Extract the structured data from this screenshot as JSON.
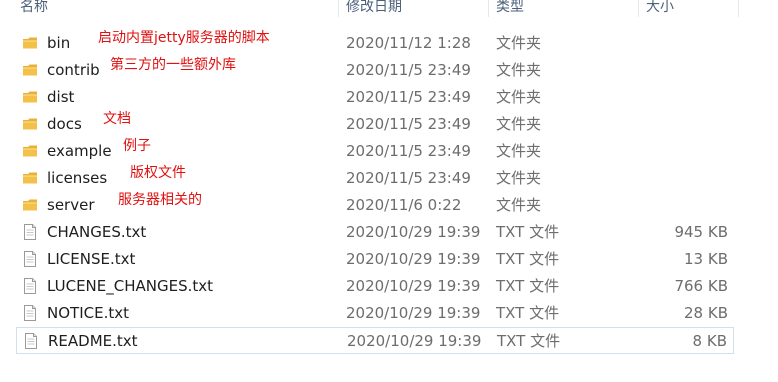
{
  "columns": {
    "name": "名称",
    "date": "修改日期",
    "type": "类型",
    "size": "大小"
  },
  "rows": [
    {
      "name": "bin",
      "date": "2020/11/12 1:28",
      "type": "文件夹",
      "size": "",
      "note": "启动内置jetty服务器的脚本",
      "icon": "folder-icon"
    },
    {
      "name": "contrib",
      "date": "2020/11/5 23:49",
      "type": "文件夹",
      "size": "",
      "note": "第三方的一些额外库",
      "icon": "folder-icon"
    },
    {
      "name": "dist",
      "date": "2020/11/5 23:49",
      "type": "文件夹",
      "size": "",
      "note": "",
      "icon": "folder-icon"
    },
    {
      "name": "docs",
      "date": "2020/11/5 23:49",
      "type": "文件夹",
      "size": "",
      "note": "文档",
      "icon": "folder-icon"
    },
    {
      "name": "example",
      "date": "2020/11/5 23:49",
      "type": "文件夹",
      "size": "",
      "note": "例子",
      "icon": "folder-icon"
    },
    {
      "name": "licenses",
      "date": "2020/11/5 23:49",
      "type": "文件夹",
      "size": "",
      "note": "版权文件",
      "icon": "folder-icon"
    },
    {
      "name": "server",
      "date": "2020/11/6 0:22",
      "type": "文件夹",
      "size": "",
      "note": "服务器相关的",
      "icon": "folder-icon"
    },
    {
      "name": "CHANGES.txt",
      "date": "2020/10/29 19:39",
      "type": "TXT 文件",
      "size": "945 KB",
      "note": "",
      "icon": "text-file-icon"
    },
    {
      "name": "LICENSE.txt",
      "date": "2020/10/29 19:39",
      "type": "TXT 文件",
      "size": "13 KB",
      "note": "",
      "icon": "text-file-icon"
    },
    {
      "name": "LUCENE_CHANGES.txt",
      "date": "2020/10/29 19:39",
      "type": "TXT 文件",
      "size": "766 KB",
      "note": "",
      "icon": "text-file-icon"
    },
    {
      "name": "NOTICE.txt",
      "date": "2020/10/29 19:39",
      "type": "TXT 文件",
      "size": "28 KB",
      "note": "",
      "icon": "text-file-icon"
    },
    {
      "name": "README.txt",
      "date": "2020/10/29 19:39",
      "type": "TXT 文件",
      "size": "8 KB",
      "note": "",
      "icon": "text-file-icon",
      "selected": true
    }
  ],
  "colors": {
    "annotation": "#e01010",
    "folder": "#f3c14a",
    "header_text": "#4c607a",
    "selection_border": "#cfe0f4"
  }
}
